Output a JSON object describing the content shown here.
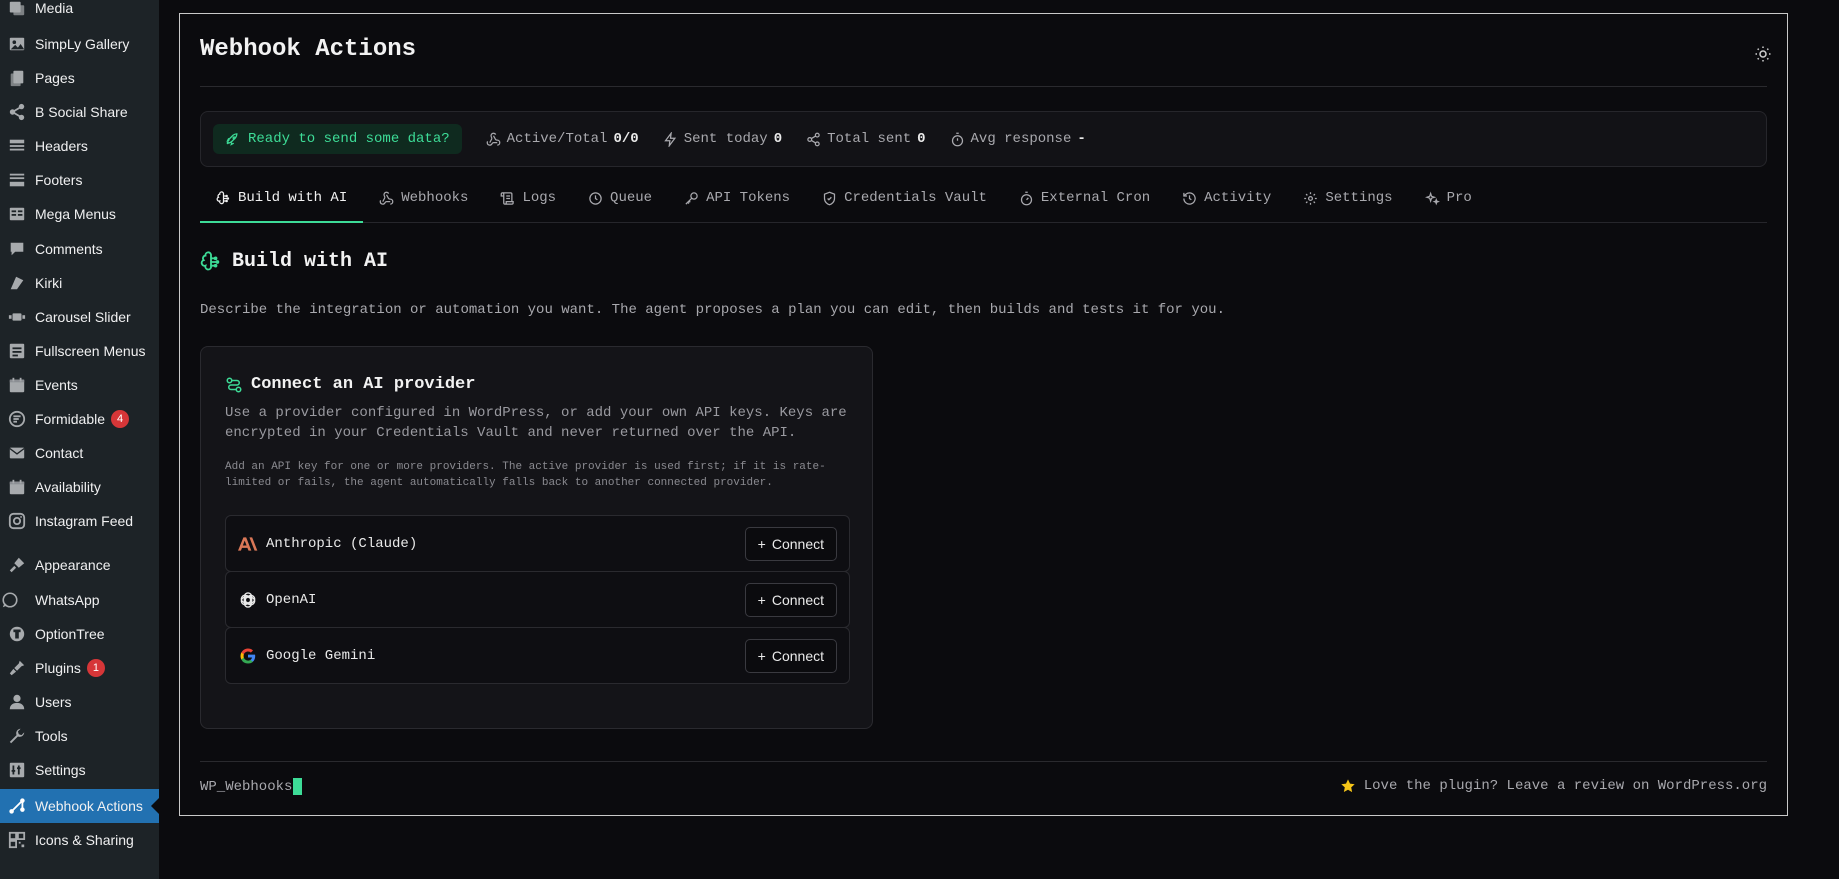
{
  "sidebar": {
    "items": [
      {
        "label": "Media",
        "icon": "media-icon"
      },
      {
        "label": "SimpLy Gallery",
        "icon": "gallery-icon"
      },
      {
        "label": "Pages",
        "icon": "pages-icon"
      },
      {
        "label": "B Social Share",
        "icon": "share-icon"
      },
      {
        "label": "Headers",
        "icon": "headers-icon"
      },
      {
        "label": "Footers",
        "icon": "footers-icon"
      },
      {
        "label": "Mega Menus",
        "icon": "mega-menus-icon"
      },
      {
        "label": "Comments",
        "icon": "comments-icon"
      },
      {
        "label": "Kirki",
        "icon": "kirki-icon"
      },
      {
        "label": "Carousel Slider",
        "icon": "carousel-icon"
      },
      {
        "label": "Fullscreen Menus",
        "icon": "fullscreen-menus-icon"
      },
      {
        "label": "Events",
        "icon": "calendar-icon"
      },
      {
        "label": "Formidable",
        "icon": "formidable-icon",
        "badge": "4"
      },
      {
        "label": "Contact",
        "icon": "envelope-icon"
      },
      {
        "label": "Availability",
        "icon": "calendar-icon"
      },
      {
        "label": "Instagram Feed",
        "icon": "instagram-icon"
      },
      {
        "label": "Appearance",
        "icon": "paintbrush-icon"
      },
      {
        "label": "WhatsApp",
        "icon": "whatsapp-icon"
      },
      {
        "label": "OptionTree",
        "icon": "optiontree-icon"
      },
      {
        "label": "Plugins",
        "icon": "plugins-icon",
        "badge": "1"
      },
      {
        "label": "Users",
        "icon": "users-icon"
      },
      {
        "label": "Tools",
        "icon": "wrench-icon"
      },
      {
        "label": "Settings",
        "icon": "settings-icon"
      },
      {
        "label": "Webhook Actions",
        "icon": "webhook-icon",
        "active": true
      },
      {
        "label": "Icons & Sharing",
        "icon": "qr-icon"
      }
    ]
  },
  "header": {
    "title": "Webhook Actions"
  },
  "stats": {
    "ready": "Ready to send some data?",
    "active_total_label": "Active/Total",
    "active_total_value": "0/0",
    "sent_today_label": "Sent today",
    "sent_today_value": "0",
    "total_sent_label": "Total sent",
    "total_sent_value": "0",
    "avg_response_label": "Avg response",
    "avg_response_value": "-"
  },
  "tabs": [
    {
      "label": "Build with AI",
      "active": true
    },
    {
      "label": "Webhooks"
    },
    {
      "label": "Logs"
    },
    {
      "label": "Queue"
    },
    {
      "label": "API Tokens"
    },
    {
      "label": "Credentials Vault"
    },
    {
      "label": "External Cron"
    },
    {
      "label": "Activity"
    },
    {
      "label": "Settings"
    },
    {
      "label": "Pro"
    }
  ],
  "section": {
    "title": "Build with AI",
    "description": "Describe the integration or automation you want. The agent proposes a plan you can edit, then builds and tests it for you."
  },
  "card": {
    "title": "Connect an AI provider",
    "description": "Use a provider configured in WordPress, or add your own API keys. Keys are encrypted in your Credentials Vault and never returned over the API.",
    "note": "Add an API key for one or more providers. The active provider is used first; if it is rate-limited or fails, the agent automatically falls back to another connected provider.",
    "providers": [
      {
        "name": "Anthropic (Claude)",
        "button": "Connect"
      },
      {
        "name": "OpenAI",
        "button": "Connect"
      },
      {
        "name": "Google Gemini",
        "button": "Connect"
      }
    ]
  },
  "footer": {
    "brand": "WP_Webhooks",
    "review": "Love the plugin? Leave a review on WordPress.org"
  },
  "colors": {
    "accent": "#3ddc97",
    "wp_active": "#2271b1",
    "anthropic": "#d97757",
    "badge": "#d63638"
  }
}
